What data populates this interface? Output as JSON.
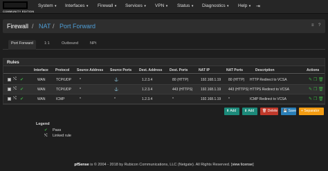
{
  "brand": {
    "edition": "COMMUNITY EDITION"
  },
  "menu": [
    {
      "label": "System"
    },
    {
      "label": "Interfaces"
    },
    {
      "label": "Firewall"
    },
    {
      "label": "Services"
    },
    {
      "label": "VPN"
    },
    {
      "label": "Status"
    },
    {
      "label": "Diagnostics"
    },
    {
      "label": "Help"
    }
  ],
  "breadcrumb": {
    "root": "Firewall",
    "sep1": "/",
    "nat": "NAT",
    "sep2": "/",
    "current": "Port Forward"
  },
  "tabs": [
    {
      "label": "Port Forward",
      "active": true
    },
    {
      "label": "1:1"
    },
    {
      "label": "Outbound"
    },
    {
      "label": "NPt"
    }
  ],
  "rules_panel": {
    "title": "Rules"
  },
  "table": {
    "headers": [
      "Interface",
      "Protocol",
      "Source Address",
      "Source Ports",
      "Dest. Address",
      "Dest. Ports",
      "NAT IP",
      "NAT Ports",
      "Description",
      "Actions"
    ],
    "rows": [
      {
        "interface": "WAN",
        "protocol": "TCP/UDP",
        "src_addr": "*",
        "src_ports": "*",
        "dest_addr": "1.2.3.4",
        "dest_ports": "80 (HTTP)",
        "nat_ip": "192.168.1.19",
        "nat_ports": "80 (HTTP)",
        "description": "HTTP Redirect to VCSA"
      },
      {
        "interface": "WAN",
        "protocol": "TCP/UDP",
        "src_addr": "*",
        "src_ports": "*",
        "dest_addr": "1.2.3.4",
        "dest_ports": "443 (HTTPS)",
        "nat_ip": "192.168.1.19",
        "nat_ports": "443 (HTTPS)",
        "description": "HTTPS Redirect to VCSA"
      },
      {
        "interface": "WAN",
        "protocol": "ICMP",
        "src_addr": "*",
        "src_ports": "*",
        "dest_addr": "1.2.3.4",
        "dest_ports": "*",
        "nat_ip": "192.168.1.19",
        "nat_ports": "*",
        "description": "ICMP Redirect to VCSA"
      }
    ]
  },
  "buttons": {
    "add_top": "Add",
    "add_bottom": "Add",
    "delete": "Delete",
    "save": "Save",
    "separator": "Separator"
  },
  "legend": {
    "title": "Legend",
    "pass": "Pass",
    "linked": "Linked rule"
  },
  "footer": {
    "brand": "pfSense",
    "text": " is © 2004 - 2018 by Rubicon Communications, LLC (Netgate). All Rights Reserved. [",
    "link": "view license",
    "end": "]"
  },
  "colors": {
    "accent": "#4f9ed6",
    "pass": "#3cb043",
    "add": "#1c8a7a",
    "delete": "#c0392b",
    "save": "#2a7fb8",
    "separator": "#f39c12"
  }
}
